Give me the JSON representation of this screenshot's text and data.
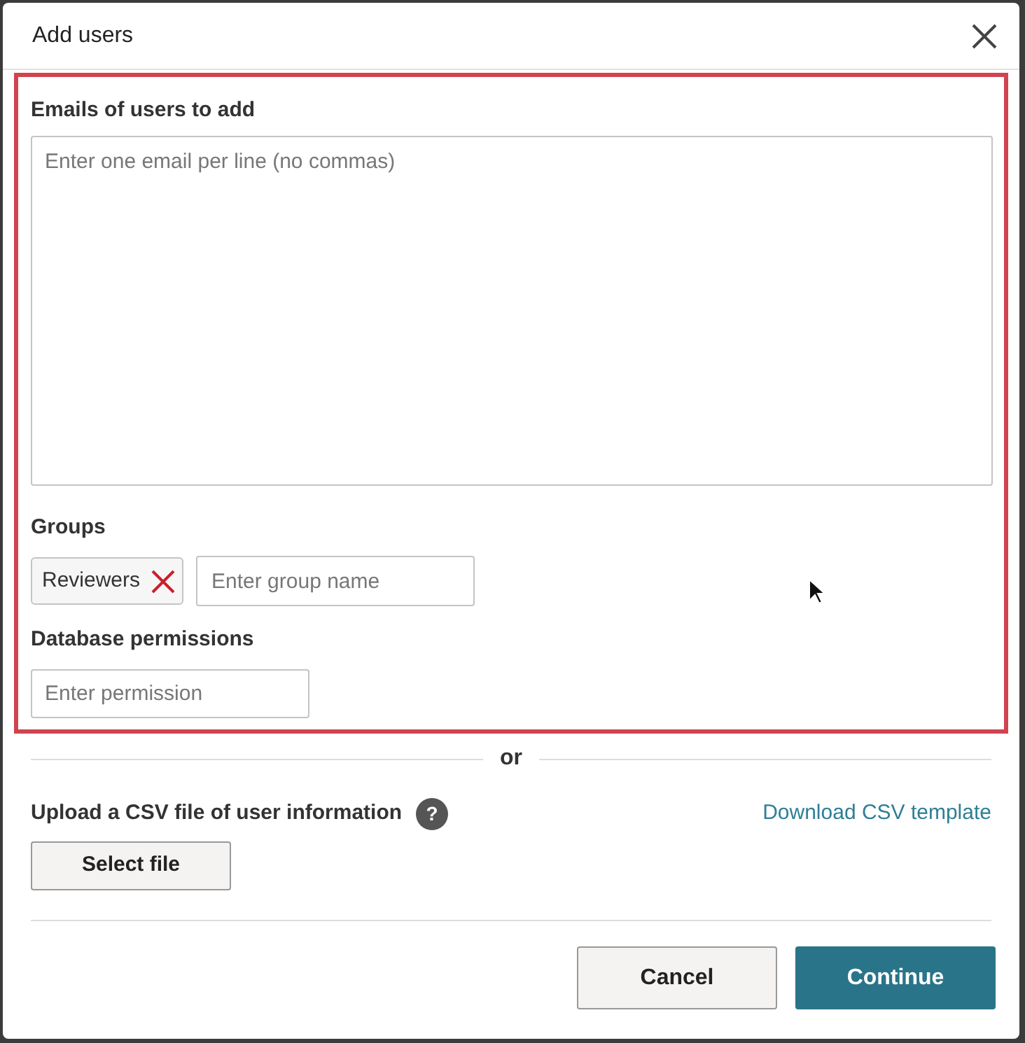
{
  "dialog": {
    "title": "Add users"
  },
  "emails": {
    "label": "Emails of users to add",
    "placeholder": "Enter one email per line (no commas)"
  },
  "groups": {
    "label": "Groups",
    "chips": [
      {
        "label": "Reviewers"
      }
    ],
    "placeholder": "Enter group name"
  },
  "permissions": {
    "label": "Database permissions",
    "placeholder": "Enter permission"
  },
  "divider": "or",
  "upload": {
    "label": "Upload a CSV file of user information",
    "help": "?",
    "button": "Select file",
    "link": "Download CSV template"
  },
  "buttons": [
    {
      "label": "Cancel",
      "kind": "secondary"
    },
    {
      "label": "Continue",
      "kind": "primary"
    }
  ]
}
